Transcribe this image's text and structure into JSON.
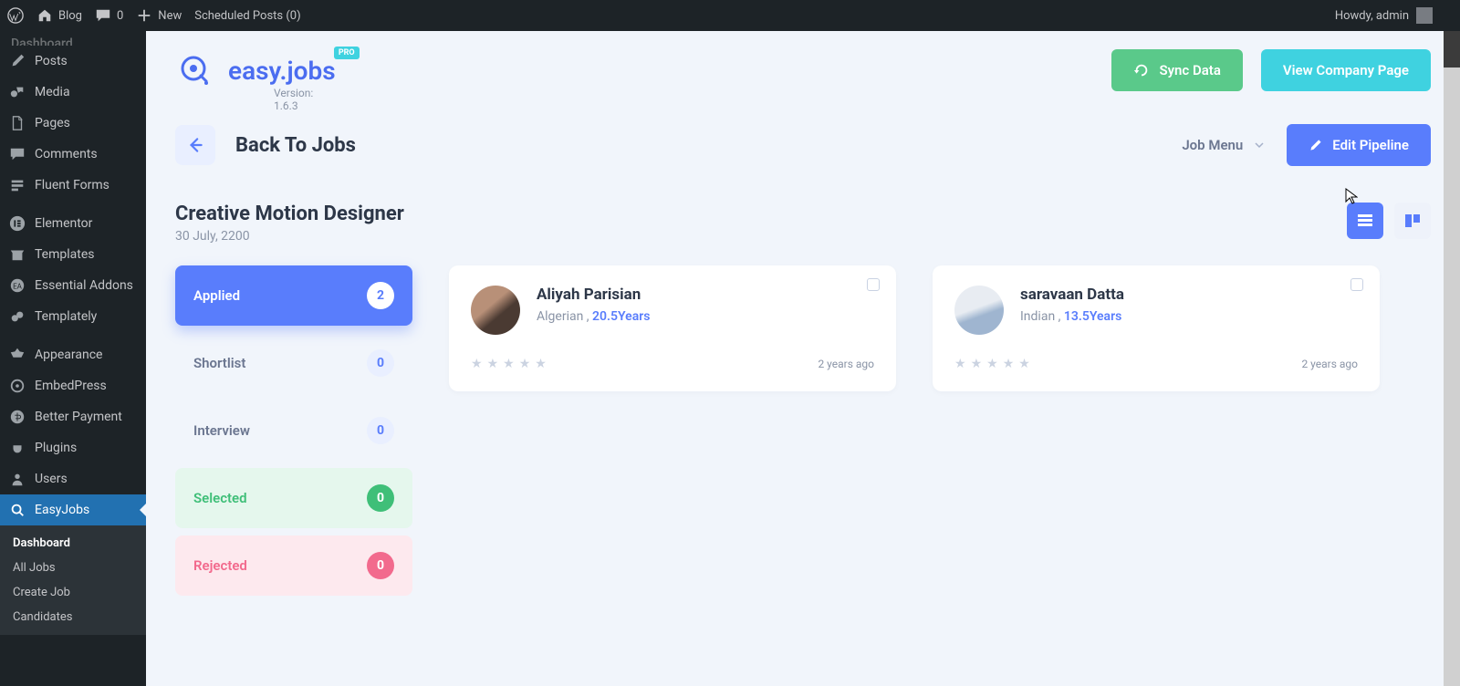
{
  "wpbar": {
    "blog": "Blog",
    "comments": "0",
    "new": "New",
    "scheduled": "Scheduled Posts (0)",
    "howdy": "Howdy, admin"
  },
  "sidebar": {
    "items": [
      {
        "label": "Posts"
      },
      {
        "label": "Media"
      },
      {
        "label": "Pages"
      },
      {
        "label": "Comments"
      },
      {
        "label": "Fluent Forms"
      },
      {
        "label": "Elementor"
      },
      {
        "label": "Templates"
      },
      {
        "label": "Essential Addons"
      },
      {
        "label": "Templately"
      },
      {
        "label": "Appearance"
      },
      {
        "label": "EmbedPress"
      },
      {
        "label": "Better Payment"
      },
      {
        "label": "Plugins"
      },
      {
        "label": "Users"
      },
      {
        "label": "EasyJobs"
      }
    ],
    "sub": [
      {
        "label": "Dashboard"
      },
      {
        "label": "All Jobs"
      },
      {
        "label": "Create Job"
      },
      {
        "label": "Candidates"
      }
    ]
  },
  "brand": {
    "title": "easy.jobs",
    "badge": "PRO",
    "version": "Version: 1.6.3"
  },
  "buttons": {
    "sync": "Sync Data",
    "view_company": "View Company Page",
    "back": "Back To Jobs",
    "job_menu": "Job Menu",
    "edit_pipeline": "Edit Pipeline"
  },
  "job": {
    "title": "Creative Motion Designer",
    "date": "30 July, 2200"
  },
  "stages": [
    {
      "label": "Applied",
      "count": "2"
    },
    {
      "label": "Shortlist",
      "count": "0"
    },
    {
      "label": "Interview",
      "count": "0"
    },
    {
      "label": "Selected",
      "count": "0"
    },
    {
      "label": "Rejected",
      "count": "0"
    }
  ],
  "candidates": [
    {
      "name": "Aliyah Parisian",
      "origin": "Algerian , ",
      "years": "20.5Years",
      "ago": "2 years ago"
    },
    {
      "name": "saravaan Datta",
      "origin": "Indian , ",
      "years": "13.5Years",
      "ago": "2 years ago"
    }
  ]
}
